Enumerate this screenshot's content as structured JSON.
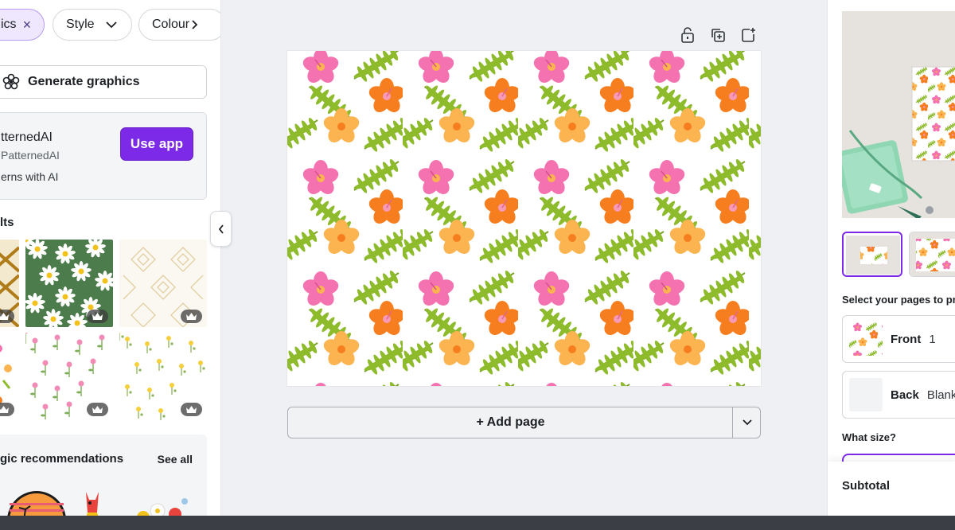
{
  "filters": {
    "active_chip": "ics",
    "active_chip_clear": "×",
    "style_chip": "Style",
    "colour_chip": "Colour"
  },
  "generate_button": "Generate graphics",
  "app_card": {
    "name": "tternedAI",
    "handle": "PatternedAI",
    "description": "erns with AI",
    "use_app_button": "Use app"
  },
  "results_title": "lts",
  "recommendations": {
    "title": "gic recommendations",
    "see_all": "See all"
  },
  "canvas": {
    "add_page_button": "+ Add page"
  },
  "print_panel": {
    "select_pages_label": "Select your pages to pri",
    "pages": [
      {
        "name": "Front",
        "value": "1"
      },
      {
        "name": "Back",
        "value": "Blank"
      }
    ],
    "size_label": "What size?",
    "subtotal_label": "Subtotal"
  },
  "colors": {
    "accent": "#7d2ae8",
    "hibiscus_pink": "#f472b0",
    "hibiscus_orange": "#f77e1f",
    "hibiscus_light": "#fbb44f",
    "palm_green": "#8dbb2c",
    "daisy_bg": "#4c7c4b"
  },
  "icons": [
    "close-icon",
    "chevron-down-icon",
    "magic-flower-icon",
    "crown-icon",
    "chevron-left-icon",
    "lock-icon",
    "duplicate-icon",
    "add-page-icon"
  ]
}
